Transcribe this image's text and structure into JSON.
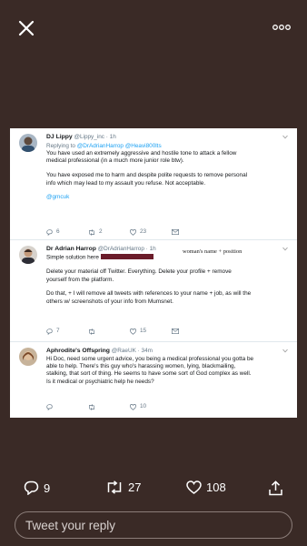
{
  "icons": {
    "close": "close-icon",
    "more": "more-dots-icon",
    "reply": "reply-icon",
    "retweet": "retweet-icon",
    "like": "heart-icon",
    "share": "share-icon",
    "chevron": "chevron-down-icon"
  },
  "tweets": [
    {
      "name": "DJ Lippy",
      "handle": "@Lippy_inc · 1h",
      "replying_prefix": "Replying to ",
      "replying_to": "@DrAdrianHarrop @Heavi800lts",
      "lines": [
        "You have used an extremely aggressive and hostile tone to attack a fellow",
        "medical professional (in a much more junior role btw).",
        "You have exposed me to harm and despite polite requests to remove personal",
        "info which may lead to my assault you refuse. Not acceptable.",
        "@gmcuk"
      ],
      "reply_count": "6",
      "retweet_count": "2",
      "like_count": "23"
    },
    {
      "name": "Dr Adrian Harrop",
      "handle": "@DrAdrianHarrop · 1h",
      "first_line": "Simple solution here",
      "annotation": "woman's name + position",
      "lines": [
        "Delete your material off Twitter. Everything. Delete your profile + remove",
        "yourself from the platform.",
        "Do that, + I will remove all tweets with references to your name + job, as will the",
        "others w/ screenshots of your info from Mumsnet."
      ],
      "reply_count": "7",
      "retweet_count": "",
      "like_count": "15"
    },
    {
      "name": "Aphrodite's Offspring",
      "handle": "@RaeUK · 34m",
      "lines": [
        "Hi Doc, need some urgent advice, you being a medical professional you  gotta be",
        "able to help. There's this guy who's harassing women, lying, blackmailing,",
        "stalking,  that sort of thing. He seems to have some sort of God complex as well.",
        "Is it medical or psychiatric help he needs?"
      ],
      "reply_count": "",
      "retweet_count": "",
      "like_count": "10"
    }
  ],
  "stats": {
    "replies": "9",
    "retweets": "27",
    "likes": "108"
  },
  "reply_placeholder": "Tweet your reply",
  "colors": {
    "background": "#3a2a26",
    "link": "#1da1f2",
    "redaction": "#6b1c2a"
  }
}
